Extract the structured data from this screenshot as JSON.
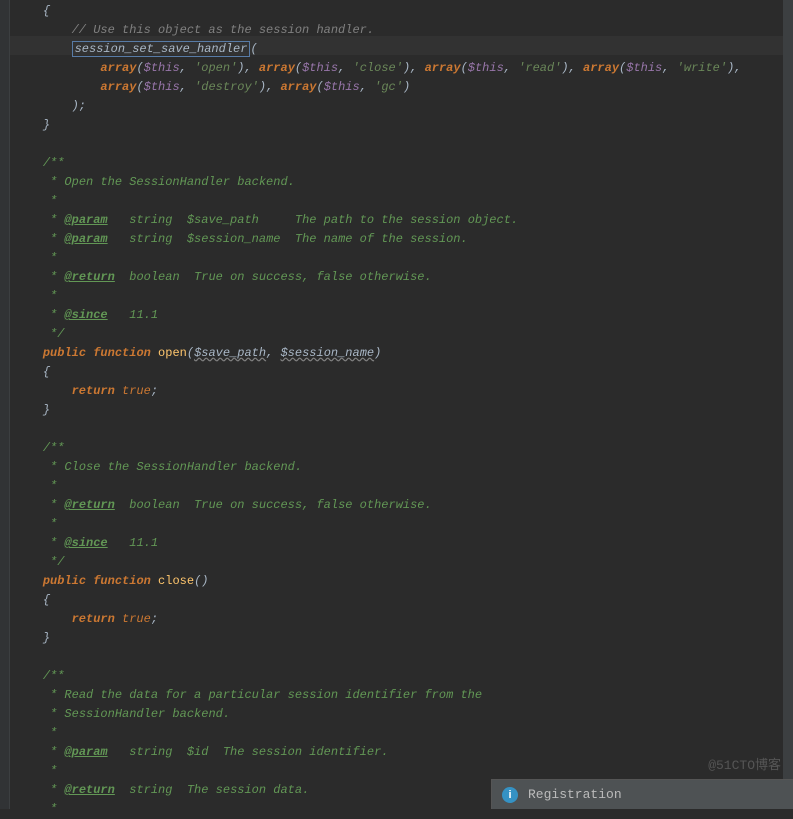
{
  "watermark": "@51CTO博客",
  "notification": {
    "icon_label": "i",
    "text": "Registration"
  },
  "code": {
    "indent1": "    ",
    "indent2": "        ",
    "indent3": "            ",
    "open_brace": "{",
    "close_brace": "}",
    "close_paren_semi": ");",
    "semi": ";",
    "l1_comment": "// Use this object as the session handler.",
    "l2_func": "session_set_save_handler",
    "l2_after": "(",
    "arr_kw": "array",
    "this_var": "$this",
    "str_open": "'open'",
    "str_close": "'close'",
    "str_read": "'read'",
    "str_write": "'write'",
    "str_destroy": "'destroy'",
    "str_gc": "'gc'",
    "doc_open": "/**",
    "doc_star": " *",
    "doc_close": " */",
    "doc_open_desc": " * Open the SessionHandler backend.",
    "doc_param": "@param",
    "doc_return": "@return",
    "doc_since": "@since",
    "doc_p1": "   string  $save_path     The path to the session object.",
    "doc_p2": "   string  $session_name  The name of the session.",
    "doc_ret_bool": "  boolean  True on success, false otherwise.",
    "doc_since_v": "   11.1",
    "public": "public",
    "function": "function",
    "fn_open": "open",
    "fn_close": "close",
    "param_save_path": "$save_path",
    "param_session_name": "$session_name",
    "return": "return",
    "true": "true",
    "doc_close_desc": " * Close the SessionHandler backend.",
    "doc_read_desc1": " * Read the data for a particular session identifier from the",
    "doc_read_desc2": " * SessionHandler backend.",
    "doc_p_id": "   string  $id  The session identifier.",
    "doc_ret_str": "  string  The session data."
  }
}
